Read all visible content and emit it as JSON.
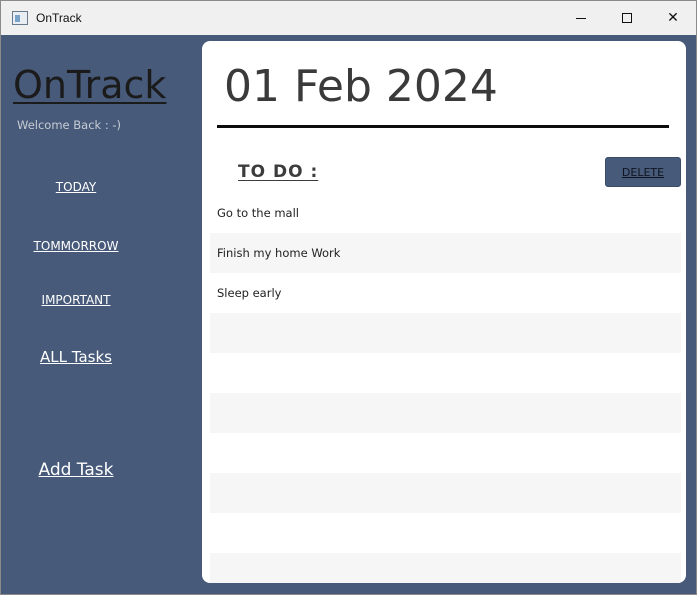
{
  "window": {
    "title": "OnTrack",
    "controls": {
      "minimize": "minimize-icon",
      "maximize": "maximize-icon",
      "close": "✕"
    }
  },
  "sidebar": {
    "brand": "OnTrack",
    "welcome": "Welcome Back : -)",
    "nav": {
      "today": "TODAY",
      "tomorrow": "TOMMORROW",
      "important": "IMPORTANT",
      "all_tasks": "ALL Tasks",
      "add_task": "Add Task"
    }
  },
  "main": {
    "date": "01 Feb 2024",
    "todo_heading": "TO DO :",
    "delete_label": "DELETE",
    "tasks": [
      "Go to the mall",
      "Finish my home Work",
      "Sleep early",
      "",
      "",
      "",
      "",
      "",
      "",
      ""
    ]
  },
  "colors": {
    "sidebar_bg": "#475a7a",
    "main_bg": "#ffffff",
    "row_alt": "#f6f6f6"
  }
}
